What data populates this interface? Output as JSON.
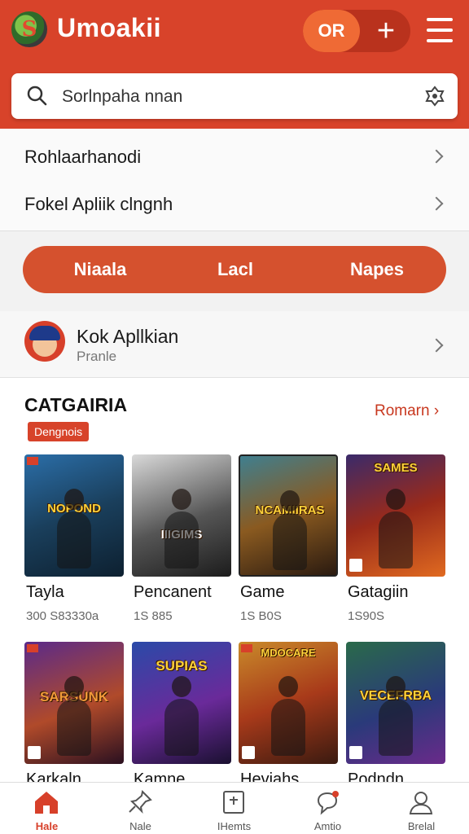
{
  "header": {
    "title": "Umoakii",
    "pill_label": "OR",
    "pill_plus": "+"
  },
  "search": {
    "text": "Sorlnpaha nnan"
  },
  "menu_list": [
    {
      "label": "Rohlaarhanodi"
    },
    {
      "label": "Fokel Apliik clngnh"
    }
  ],
  "segments": [
    "Niaala",
    "Lacl",
    "Napes"
  ],
  "featured_app": {
    "name": "Kok Apllkian",
    "subtitle": "Pranle"
  },
  "section": {
    "title": "CATGAIRIA",
    "link": "Romarn",
    "badge": "Dengnois"
  },
  "tiles": [
    {
      "art_title": "NOPOND",
      "name": "Tayla",
      "size": "300 S83330a"
    },
    {
      "art_title": "IIIGIMS",
      "name": "Pencanent",
      "size": "1S 885"
    },
    {
      "art_title": "NCAMIIRAS",
      "name": "Game",
      "size": "1S B0S"
    },
    {
      "art_title": "SAMES",
      "name": "Gatagiin",
      "size": "1S90S"
    },
    {
      "art_title": "SARSUNK",
      "name": "Karkaln",
      "size": ""
    },
    {
      "art_title": "SUPIAS",
      "name": "Kamne",
      "size": ""
    },
    {
      "art_title": "MDOCARE",
      "name": "Heviahs",
      "size": ""
    },
    {
      "art_title": "VECEFRBA",
      "name": "Podndn",
      "size": ""
    }
  ],
  "nav": [
    {
      "label": "Hale",
      "icon": "home-icon"
    },
    {
      "label": "Nale",
      "icon": "pin-icon"
    },
    {
      "label": "IHemts",
      "icon": "calendar-icon"
    },
    {
      "label": "Amtio",
      "icon": "chat-icon"
    },
    {
      "label": "Brelal",
      "icon": "profile-icon"
    }
  ],
  "colors": {
    "brand": "#d8432a",
    "pill_accent": "#ef6a35",
    "link": "#c8381f"
  }
}
